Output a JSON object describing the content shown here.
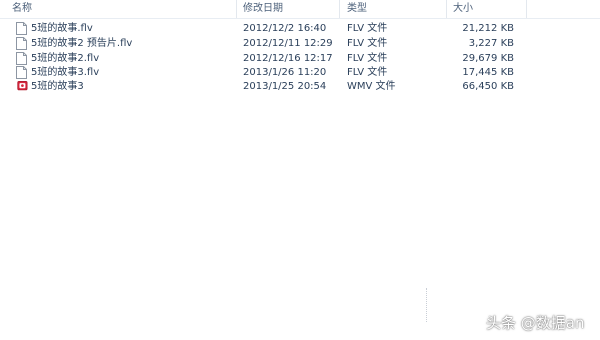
{
  "columns": {
    "name": "名称",
    "modified": "修改日期",
    "type": "类型",
    "size": "大小"
  },
  "files": [
    {
      "name": "5班的故事.flv",
      "modified": "2012/12/2 16:40",
      "type": "FLV 文件",
      "size": "21,212 KB",
      "icon": "document-icon"
    },
    {
      "name": "5班的故事2 预告片.flv",
      "modified": "2012/12/11 12:29",
      "type": "FLV 文件",
      "size": "3,227 KB",
      "icon": "document-icon"
    },
    {
      "name": "5班的故事2.flv",
      "modified": "2012/12/16 12:17",
      "type": "FLV 文件",
      "size": "29,679 KB",
      "icon": "document-icon"
    },
    {
      "name": "5班的故事3.flv",
      "modified": "2013/1/26 11:20",
      "type": "FLV 文件",
      "size": "17,445 KB",
      "icon": "document-icon"
    },
    {
      "name": "5班的故事3",
      "modified": "2013/1/25 20:54",
      "type": "WMV 文件",
      "size": "66,450 KB",
      "icon": "video-file-icon"
    }
  ],
  "colors": {
    "video_icon": "#d7263d",
    "header_text": "#4c607a",
    "row_text": "#2a3f5a"
  },
  "watermark": {
    "text": "头条 @数据an"
  }
}
